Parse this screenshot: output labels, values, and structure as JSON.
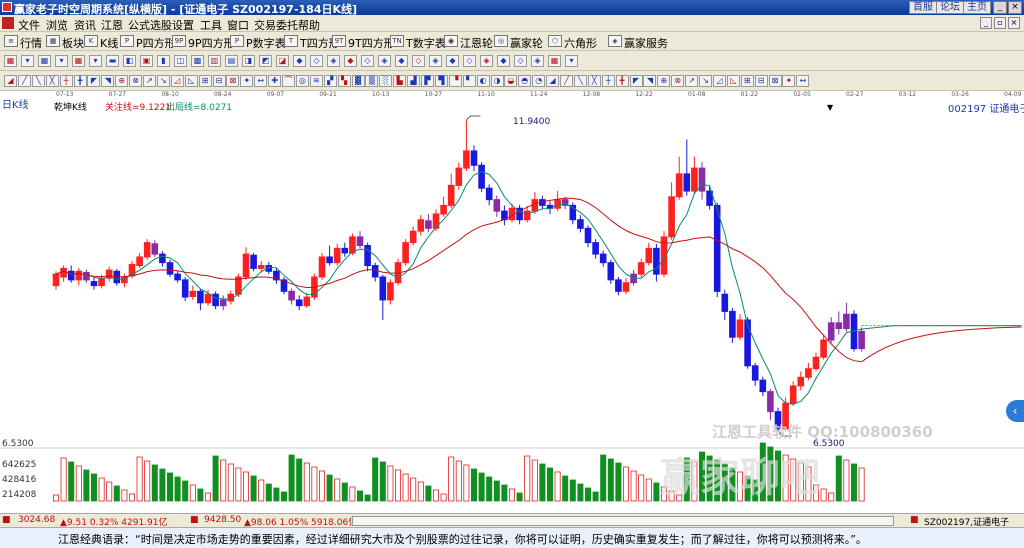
{
  "titlebar": {
    "title": "赢家老子时空周期系统[纵横版] - [证通电子  SZ002197-184日K线]",
    "buttons": [
      "首服",
      "论坛",
      "主页"
    ]
  },
  "menu": [
    "文件",
    "浏览",
    "资讯",
    "江恩",
    "公式选股",
    "设置",
    "工具",
    "窗口",
    "交易委托",
    "帮助"
  ],
  "toolbar1": [
    {
      "icon": "line-chart-icon",
      "glyph": "≡",
      "label": "行情"
    },
    {
      "icon": "board-icon",
      "glyph": "▦",
      "label": "板块"
    },
    {
      "icon": "kline-icon",
      "glyph": "K",
      "label": "K线"
    },
    {
      "icon": "p-square-icon",
      "glyph": "P",
      "label": "P四方形"
    },
    {
      "icon": "9p-square-icon",
      "glyph": "9P",
      "label": "9P四方形"
    },
    {
      "icon": "p-digit-table-icon",
      "glyph": "P",
      "label": "P数字表"
    },
    {
      "icon": "t-square-icon",
      "glyph": "T",
      "label": "T四方形"
    },
    {
      "icon": "9t-square-icon",
      "glyph": "9T",
      "label": "9T四方形"
    },
    {
      "icon": "t-digit-table-icon",
      "glyph": "TN",
      "label": "T数字表"
    },
    {
      "icon": "gann-wheel-icon",
      "glyph": "◉",
      "label": "江恩轮"
    },
    {
      "icon": "winner-wheel-icon",
      "glyph": "◎",
      "label": "赢家轮"
    },
    {
      "icon": "hexagon-icon",
      "glyph": "⬡",
      "label": "六角形"
    },
    {
      "icon": "service-icon",
      "glyph": "◈",
      "label": "赢家服务"
    }
  ],
  "chart_header": {
    "period": "日K线",
    "indicator": "乾坤K线",
    "focus_line": "关注线=9.1221",
    "exit_line": "出局线=8.0271",
    "stock": "002197  证通电子"
  },
  "date_ticks": [
    "07-13",
    "07-27",
    "08-10",
    "08-24",
    "09-07",
    "09-21",
    "10-13",
    "10-27",
    "11-10",
    "11-24",
    "12-08",
    "12-22",
    "01-08",
    "01-22",
    "02-05",
    "02-27",
    "03-12",
    "03-26",
    "04-09"
  ],
  "price_labels": {
    "high": "11.9400",
    "low": "6.5300"
  },
  "volume_axis": {
    "top": "6.5300",
    "ticks": [
      "642625",
      "428416",
      "214208"
    ]
  },
  "watermark": {
    "line1": "江恩工具软件  QQ:100800360",
    "line2": "赢家聊吧"
  },
  "statusbar": {
    "sh_index": "3024.68",
    "sh_change": "▲9.51 0.32% 4291.91亿",
    "sz_index": "9428.50",
    "sz_change": "▲98.06 1.05% 5918.06亿",
    "stock_tab": "SZ002197,证通电子"
  },
  "quote": "江恩经典语录：“时间是决定市场走势的重要因素，经过详细研究大市及个别股票的过往记录，你将可以证明，历史确实重复发生；而了解过往，你将可以预测将来。”。",
  "colors": {
    "up": "#ff2020",
    "down": "#1818e0",
    "purple": "#8a2aa8",
    "ma_short": "#0a8a6a",
    "ma_long": "#c81010",
    "volume_up": "#e02020",
    "volume_down": "#109020"
  },
  "chart_data": {
    "type": "candlestick",
    "y_range": [
      6.53,
      11.94
    ],
    "candles": [
      [
        9.05,
        9.25,
        9.3,
        8.98
      ],
      [
        9.2,
        9.35,
        9.4,
        9.12
      ],
      [
        9.3,
        9.15,
        9.4,
        9.1
      ],
      [
        9.15,
        9.3,
        9.36,
        9.05
      ],
      [
        9.28,
        9.15,
        9.33,
        9.1
      ],
      [
        9.12,
        9.05,
        9.2,
        8.98
      ],
      [
        9.05,
        9.18,
        9.24,
        9.0
      ],
      [
        9.18,
        9.32,
        9.38,
        9.12
      ],
      [
        9.3,
        9.1,
        9.34,
        9.05
      ],
      [
        9.1,
        9.2,
        9.26,
        9.02
      ],
      [
        9.22,
        9.42,
        9.48,
        9.18
      ],
      [
        9.4,
        9.55,
        9.62,
        9.36
      ],
      [
        9.55,
        9.8,
        9.86,
        9.5
      ],
      [
        9.78,
        9.6,
        9.84,
        9.55
      ],
      [
        9.6,
        9.45,
        9.65,
        9.38
      ],
      [
        9.45,
        9.25,
        9.5,
        9.2
      ],
      [
        9.25,
        9.15,
        9.3,
        9.1
      ],
      [
        9.15,
        8.85,
        9.2,
        8.78
      ],
      [
        8.86,
        8.95,
        9.05,
        8.8
      ],
      [
        8.95,
        8.75,
        9.0,
        8.62
      ],
      [
        8.75,
        8.9,
        8.98,
        8.7
      ],
      [
        8.9,
        8.7,
        8.95,
        8.64
      ],
      [
        8.7,
        8.8,
        8.88,
        8.62
      ],
      [
        8.78,
        8.9,
        8.96,
        8.72
      ],
      [
        8.9,
        9.2,
        9.26,
        8.85
      ],
      [
        9.2,
        9.6,
        9.72,
        9.15
      ],
      [
        9.58,
        9.35,
        9.62,
        9.3
      ],
      [
        9.35,
        9.4,
        9.48,
        9.28
      ],
      [
        9.4,
        9.3,
        9.46,
        9.25
      ],
      [
        9.3,
        9.15,
        9.35,
        9.08
      ],
      [
        9.15,
        8.95,
        9.2,
        8.9
      ],
      [
        8.95,
        8.8,
        9.0,
        8.72
      ],
      [
        8.8,
        8.7,
        8.88,
        8.62
      ],
      [
        8.7,
        8.85,
        8.92,
        8.66
      ],
      [
        8.85,
        9.2,
        9.26,
        8.8
      ],
      [
        9.2,
        9.55,
        9.62,
        9.15
      ],
      [
        9.55,
        9.45,
        9.75,
        9.4
      ],
      [
        9.45,
        9.7,
        9.78,
        9.4
      ],
      [
        9.7,
        9.62,
        9.8,
        9.55
      ],
      [
        9.62,
        9.9,
        9.96,
        9.58
      ],
      [
        9.9,
        9.75,
        10.0,
        9.7
      ],
      [
        9.75,
        9.4,
        9.8,
        9.3
      ],
      [
        9.4,
        9.2,
        9.45,
        9.12
      ],
      [
        9.2,
        8.8,
        9.24,
        8.45
      ],
      [
        8.8,
        9.1,
        9.16,
        8.72
      ],
      [
        9.1,
        9.45,
        9.52,
        9.05
      ],
      [
        9.45,
        9.8,
        9.86,
        9.4
      ],
      [
        9.8,
        10.0,
        10.08,
        9.75
      ],
      [
        10.0,
        10.2,
        10.28,
        9.92
      ],
      [
        10.18,
        10.05,
        10.3,
        9.98
      ],
      [
        10.05,
        10.3,
        10.38,
        10.0
      ],
      [
        10.3,
        10.45,
        10.6,
        10.25
      ],
      [
        10.45,
        10.8,
        11.0,
        10.4
      ],
      [
        10.8,
        11.1,
        11.2,
        10.72
      ],
      [
        11.1,
        11.4,
        11.94,
        11.05
      ],
      [
        11.4,
        11.15,
        11.5,
        11.05
      ],
      [
        11.15,
        10.75,
        11.2,
        10.68
      ],
      [
        10.75,
        10.55,
        10.82,
        10.45
      ],
      [
        10.55,
        10.35,
        10.62,
        10.25
      ],
      [
        10.35,
        10.2,
        10.45,
        10.1
      ],
      [
        10.2,
        10.4,
        10.48,
        10.15
      ],
      [
        10.4,
        10.2,
        10.46,
        10.12
      ],
      [
        10.2,
        10.35,
        10.44,
        10.15
      ],
      [
        10.35,
        10.55,
        10.68,
        10.3
      ],
      [
        10.55,
        10.45,
        10.62,
        10.38
      ],
      [
        10.45,
        10.4,
        10.52,
        10.3
      ],
      [
        10.4,
        10.55,
        10.7,
        10.35
      ],
      [
        10.55,
        10.45,
        10.6,
        10.38
      ],
      [
        10.45,
        10.2,
        10.5,
        10.12
      ],
      [
        10.2,
        10.05,
        10.28,
        9.98
      ],
      [
        10.05,
        9.8,
        10.1,
        9.72
      ],
      [
        9.8,
        9.6,
        9.86,
        9.52
      ],
      [
        9.6,
        9.45,
        9.66,
        9.38
      ],
      [
        9.45,
        9.15,
        9.5,
        9.08
      ],
      [
        9.15,
        8.95,
        9.2,
        8.88
      ],
      [
        8.95,
        9.1,
        9.18,
        8.9
      ],
      [
        9.1,
        9.25,
        9.32,
        9.05
      ],
      [
        9.25,
        9.45,
        9.52,
        9.2
      ],
      [
        9.45,
        9.7,
        9.8,
        9.4
      ],
      [
        9.7,
        9.25,
        9.78,
        9.12
      ],
      [
        9.25,
        9.9,
        10.0,
        9.2
      ],
      [
        9.9,
        10.6,
        10.85,
        9.85
      ],
      [
        10.6,
        11.0,
        11.3,
        10.55
      ],
      [
        11.0,
        10.7,
        11.6,
        10.62
      ],
      [
        10.7,
        11.1,
        11.3,
        10.64
      ],
      [
        11.1,
        10.7,
        11.2,
        10.55
      ],
      [
        10.7,
        10.45,
        10.8,
        10.38
      ],
      [
        10.45,
        8.95,
        10.5,
        8.85
      ],
      [
        8.9,
        8.6,
        8.98,
        8.45
      ],
      [
        8.6,
        8.15,
        8.66,
        8.05
      ],
      [
        8.15,
        8.45,
        8.55,
        8.1
      ],
      [
        8.45,
        7.65,
        8.5,
        7.6
      ],
      [
        7.65,
        7.4,
        7.7,
        7.3
      ],
      [
        7.4,
        7.2,
        7.46,
        7.12
      ],
      [
        7.2,
        6.85,
        7.25,
        6.7
      ],
      [
        6.85,
        6.55,
        6.92,
        6.53
      ],
      [
        6.55,
        7.0,
        7.1,
        6.53
      ],
      [
        7.0,
        7.3,
        7.38,
        6.95
      ],
      [
        7.3,
        7.45,
        7.55,
        7.22
      ],
      [
        7.45,
        7.6,
        7.7,
        7.4
      ],
      [
        7.6,
        7.8,
        7.88,
        7.55
      ],
      [
        7.8,
        8.1,
        8.2,
        7.76
      ],
      [
        8.1,
        8.4,
        8.5,
        8.05
      ],
      [
        8.4,
        8.3,
        8.6,
        8.2
      ],
      [
        8.3,
        8.55,
        8.75,
        8.25
      ],
      [
        8.55,
        7.95,
        8.62,
        7.9
      ],
      [
        7.95,
        8.25,
        8.32,
        7.9
      ]
    ],
    "volume_ticks": [
      642625,
      428416,
      214208
    ]
  }
}
